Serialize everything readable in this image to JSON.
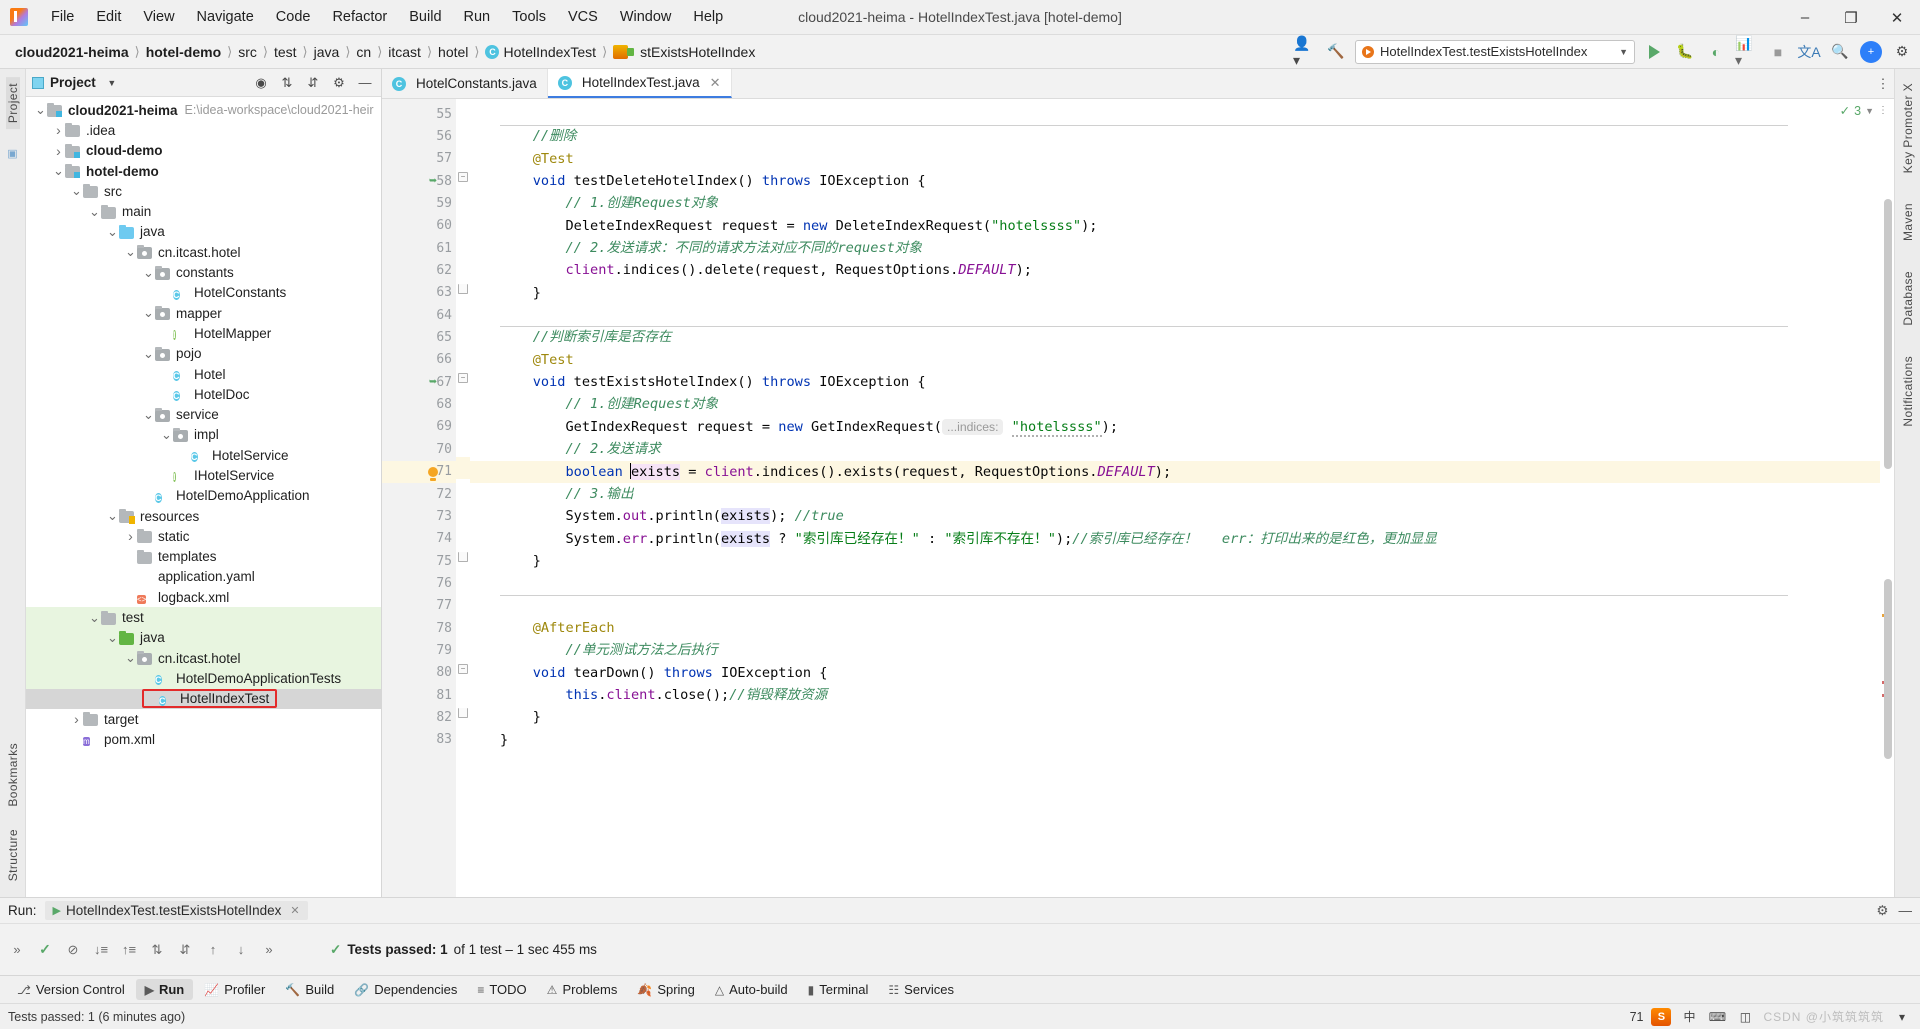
{
  "window": {
    "title": "cloud2021-heima - HotelIndexTest.java [hotel-demo]",
    "minimize": "–",
    "maximize": "❐",
    "close": "✕"
  },
  "menubar": {
    "items": [
      "File",
      "Edit",
      "View",
      "Navigate",
      "Code",
      "Refactor",
      "Build",
      "Run",
      "Tools",
      "VCS",
      "Window",
      "Help"
    ]
  },
  "breadcrumb": {
    "items": [
      {
        "label": "cloud2021-heima",
        "bold": true
      },
      {
        "label": "hotel-demo",
        "bold": true
      },
      {
        "label": "src",
        "bold": false
      },
      {
        "label": "test",
        "bold": false
      },
      {
        "label": "java",
        "bold": false
      },
      {
        "label": "cn",
        "bold": false
      },
      {
        "label": "itcast",
        "bold": false
      },
      {
        "label": "hotel",
        "bold": false
      },
      {
        "label": "HotelIndexTest",
        "bold": false,
        "icon": "class-icon"
      },
      {
        "label": "stExistsHotelIndex",
        "bold": false,
        "icon": "method-icon"
      }
    ]
  },
  "toolbar": {
    "run_configuration": "HotelIndexTest.testExistsHotelIndex",
    "run_tooltip": "Run",
    "debug_tooltip": "Debug",
    "coverage_tooltip": "Run with Coverage",
    "profiler_tooltip": "Profiler",
    "stop_tooltip": "Stop",
    "translate_tooltip": "Translate",
    "search_tooltip": "Search Everywhere",
    "settings_tooltip": "Settings",
    "user_initial": "👤",
    "update_badge": "+"
  },
  "left_strip": {
    "items": [
      "Project",
      "Bookmarks",
      "Structure"
    ]
  },
  "right_strip": {
    "items": [
      "Key Promoter X",
      "Maven",
      "Database",
      "Notifications"
    ]
  },
  "project_panel": {
    "title": "Project",
    "tree": [
      {
        "depth": 0,
        "arrow": "v",
        "icon": "module-folder",
        "label": "cloud2021-heima",
        "bold": true,
        "path": "E:\\idea-workspace\\cloud2021-heir"
      },
      {
        "depth": 1,
        "arrow": ">",
        "icon": "folder",
        "label": ".idea",
        "bold": false
      },
      {
        "depth": 1,
        "arrow": ">",
        "icon": "module-folder",
        "label": "cloud-demo",
        "bold": true
      },
      {
        "depth": 1,
        "arrow": "v",
        "icon": "module-folder",
        "label": "hotel-demo",
        "bold": true
      },
      {
        "depth": 2,
        "arrow": "v",
        "icon": "folder",
        "label": "src",
        "bold": false
      },
      {
        "depth": 3,
        "arrow": "v",
        "icon": "folder",
        "label": "main",
        "bold": false
      },
      {
        "depth": 4,
        "arrow": "v",
        "icon": "source-folder",
        "label": "java",
        "bold": false
      },
      {
        "depth": 5,
        "arrow": "v",
        "icon": "package",
        "label": "cn.itcast.hotel",
        "bold": false
      },
      {
        "depth": 6,
        "arrow": "v",
        "icon": "package",
        "label": "constants",
        "bold": false
      },
      {
        "depth": 7,
        "arrow": "",
        "icon": "class",
        "label": "HotelConstants",
        "bold": false
      },
      {
        "depth": 6,
        "arrow": "v",
        "icon": "package",
        "label": "mapper",
        "bold": false
      },
      {
        "depth": 7,
        "arrow": "",
        "icon": "interface",
        "label": "HotelMapper",
        "bold": false
      },
      {
        "depth": 6,
        "arrow": "v",
        "icon": "package",
        "label": "pojo",
        "bold": false
      },
      {
        "depth": 7,
        "arrow": "",
        "icon": "class",
        "label": "Hotel",
        "bold": false
      },
      {
        "depth": 7,
        "arrow": "",
        "icon": "class",
        "label": "HotelDoc",
        "bold": false
      },
      {
        "depth": 6,
        "arrow": "v",
        "icon": "package",
        "label": "service",
        "bold": false
      },
      {
        "depth": 7,
        "arrow": "v",
        "icon": "package",
        "label": "impl",
        "bold": false
      },
      {
        "depth": 8,
        "arrow": "",
        "icon": "class",
        "label": "HotelService",
        "bold": false
      },
      {
        "depth": 7,
        "arrow": "",
        "icon": "interface",
        "label": "IHotelService",
        "bold": false
      },
      {
        "depth": 6,
        "arrow": "",
        "icon": "spring-class",
        "label": "HotelDemoApplication",
        "bold": false
      },
      {
        "depth": 4,
        "arrow": "v",
        "icon": "resource-folder",
        "label": "resources",
        "bold": false
      },
      {
        "depth": 5,
        "arrow": ">",
        "icon": "folder",
        "label": "static",
        "bold": false
      },
      {
        "depth": 5,
        "arrow": "",
        "icon": "folder",
        "label": "templates",
        "bold": false
      },
      {
        "depth": 5,
        "arrow": "",
        "icon": "yaml-file",
        "label": "application.yaml",
        "bold": false
      },
      {
        "depth": 5,
        "arrow": "",
        "icon": "xml-file",
        "label": "logback.xml",
        "bold": false
      },
      {
        "depth": 3,
        "arrow": "v",
        "icon": "folder",
        "label": "test",
        "bold": false,
        "highlight": "green"
      },
      {
        "depth": 4,
        "arrow": "v",
        "icon": "test-source-folder",
        "label": "java",
        "bold": false,
        "highlight": "green"
      },
      {
        "depth": 5,
        "arrow": "v",
        "icon": "package",
        "label": "cn.itcast.hotel",
        "bold": false,
        "highlight": "green"
      },
      {
        "depth": 6,
        "arrow": "",
        "icon": "test-class",
        "label": "HotelDemoApplicationTests",
        "bold": false,
        "highlight": "green"
      },
      {
        "depth": 6,
        "arrow": "",
        "icon": "test-class",
        "label": "HotelIndexTest",
        "bold": false,
        "highlight": "selected",
        "outlined": true
      },
      {
        "depth": 2,
        "arrow": ">",
        "icon": "folder",
        "label": "target",
        "bold": false
      },
      {
        "depth": 2,
        "arrow": "",
        "icon": "maven-file",
        "label": "pom.xml",
        "bold": false
      }
    ]
  },
  "editor": {
    "tabs": [
      {
        "label": "HotelConstants.java",
        "icon": "class-icon",
        "active": false,
        "closable": false
      },
      {
        "label": "HotelIndexTest.java",
        "icon": "test-class-icon",
        "active": true,
        "closable": true
      }
    ],
    "inspection_count": "3",
    "lines": [
      {
        "n": "55",
        "segments": []
      },
      {
        "n": "56",
        "segments": [
          {
            "t": "    //删除",
            "c": "com-green"
          }
        ],
        "separator_above": true
      },
      {
        "n": "57",
        "segments": [
          {
            "t": "    @Test",
            "c": "ann"
          }
        ]
      },
      {
        "n": "58",
        "segments": [
          {
            "t": "    ",
            "c": "plain"
          },
          {
            "t": "void",
            "c": "kw"
          },
          {
            "t": " testDeleteHotelIndex() ",
            "c": "plain"
          },
          {
            "t": "throws",
            "c": "kw"
          },
          {
            "t": " IOException {",
            "c": "plain"
          }
        ],
        "gutter_icon": "run-test",
        "fold": "collapse"
      },
      {
        "n": "59",
        "segments": [
          {
            "t": "        // 1.创建Request对象",
            "c": "com-green"
          }
        ]
      },
      {
        "n": "60",
        "segments": [
          {
            "t": "        DeleteIndexRequest request = ",
            "c": "plain"
          },
          {
            "t": "new",
            "c": "kw"
          },
          {
            "t": " DeleteIndexRequest(",
            "c": "plain"
          },
          {
            "t": "\"hotelssss\"",
            "c": "str"
          },
          {
            "t": ");",
            "c": "plain"
          }
        ]
      },
      {
        "n": "61",
        "segments": [
          {
            "t": "        // 2.发送请求：不同的请求方法对应不同的request对象",
            "c": "com-green"
          }
        ]
      },
      {
        "n": "62",
        "segments": [
          {
            "t": "        ",
            "c": "plain"
          },
          {
            "t": "client",
            "c": "fld"
          },
          {
            "t": ".indices().delete(request, RequestOptions.",
            "c": "plain"
          },
          {
            "t": "DEFAULT",
            "c": "stat"
          },
          {
            "t": ");",
            "c": "plain"
          }
        ]
      },
      {
        "n": "63",
        "segments": [
          {
            "t": "    }",
            "c": "plain"
          }
        ],
        "fold": "end"
      },
      {
        "n": "64",
        "segments": []
      },
      {
        "n": "65",
        "segments": [
          {
            "t": "    //判断索引库是否存在",
            "c": "com-green"
          }
        ],
        "separator_above": true
      },
      {
        "n": "66",
        "segments": [
          {
            "t": "    @Test",
            "c": "ann"
          }
        ]
      },
      {
        "n": "67",
        "segments": [
          {
            "t": "    ",
            "c": "plain"
          },
          {
            "t": "void",
            "c": "kw"
          },
          {
            "t": " testExistsHotelIndex() ",
            "c": "plain"
          },
          {
            "t": "throws",
            "c": "kw"
          },
          {
            "t": " IOException {",
            "c": "plain"
          }
        ],
        "gutter_icon": "run-test",
        "fold": "collapse"
      },
      {
        "n": "68",
        "segments": [
          {
            "t": "        // 1.创建Request对象",
            "c": "com-green"
          }
        ]
      },
      {
        "n": "69",
        "segments": [
          {
            "t": "        GetIndexRequest request = ",
            "c": "plain"
          },
          {
            "t": "new",
            "c": "kw"
          },
          {
            "t": " GetIndexRequest(",
            "c": "plain"
          },
          {
            "t": "...indices:",
            "c": "hint"
          },
          {
            "t": " ",
            "c": "plain"
          },
          {
            "t": "\"hotelssss\"",
            "c": "str-wavy"
          },
          {
            "t": ");",
            "c": "plain"
          }
        ]
      },
      {
        "n": "70",
        "segments": [
          {
            "t": "        // 2.发送请求",
            "c": "com-green"
          }
        ]
      },
      {
        "n": "71",
        "segments": [
          {
            "t": "        ",
            "c": "plain"
          },
          {
            "t": "boolean",
            "c": "kw"
          },
          {
            "t": " ",
            "c": "plain"
          },
          {
            "t": "|exists",
            "c": "ident-caret"
          },
          {
            "t": " = ",
            "c": "plain"
          },
          {
            "t": "client",
            "c": "fld"
          },
          {
            "t": ".indices().exists(request, RequestOptions.",
            "c": "plain"
          },
          {
            "t": "DEFAULT",
            "c": "stat"
          },
          {
            "t": ");",
            "c": "plain"
          }
        ],
        "gutter_icon": "bulb",
        "highlight": true
      },
      {
        "n": "72",
        "segments": [
          {
            "t": "        // 3.输出",
            "c": "com-green"
          }
        ]
      },
      {
        "n": "73",
        "segments": [
          {
            "t": "        System.",
            "c": "plain"
          },
          {
            "t": "out",
            "c": "fld"
          },
          {
            "t": ".println(",
            "c": "plain"
          },
          {
            "t": "exists",
            "c": "ident-hl2"
          },
          {
            "t": "); ",
            "c": "plain"
          },
          {
            "t": "//true",
            "c": "com-green"
          }
        ]
      },
      {
        "n": "74",
        "segments": [
          {
            "t": "        System.",
            "c": "plain"
          },
          {
            "t": "err",
            "c": "fld"
          },
          {
            "t": ".println(",
            "c": "plain"
          },
          {
            "t": "exists",
            "c": "ident-hl2"
          },
          {
            "t": " ? ",
            "c": "plain"
          },
          {
            "t": "\"索引库已经存在！\"",
            "c": "str"
          },
          {
            "t": " : ",
            "c": "plain"
          },
          {
            "t": "\"索引库不存在！\"",
            "c": "str"
          },
          {
            "t": ");",
            "c": "plain"
          },
          {
            "t": "//索引库已经存在！   err：打印出来的是红色，更加显显",
            "c": "com-green"
          }
        ]
      },
      {
        "n": "75",
        "segments": [
          {
            "t": "    }",
            "c": "plain"
          }
        ],
        "fold": "end"
      },
      {
        "n": "76",
        "segments": []
      },
      {
        "n": "77",
        "segments": [],
        "separator_above": true
      },
      {
        "n": "78",
        "segments": [
          {
            "t": "    @AfterEach",
            "c": "ann"
          }
        ]
      },
      {
        "n": "79",
        "segments": [
          {
            "t": "        //单元测试方法之后执行",
            "c": "com-green"
          }
        ]
      },
      {
        "n": "80",
        "segments": [
          {
            "t": "    ",
            "c": "plain"
          },
          {
            "t": "void",
            "c": "kw"
          },
          {
            "t": " tearDown() ",
            "c": "plain"
          },
          {
            "t": "throws",
            "c": "kw"
          },
          {
            "t": " IOException {",
            "c": "plain"
          }
        ],
        "fold": "collapse"
      },
      {
        "n": "81",
        "segments": [
          {
            "t": "        ",
            "c": "plain"
          },
          {
            "t": "this",
            "c": "kw"
          },
          {
            "t": ".",
            "c": "plain"
          },
          {
            "t": "client",
            "c": "fld"
          },
          {
            "t": ".close();",
            "c": "plain"
          },
          {
            "t": "//销毁释放资源",
            "c": "com-green"
          }
        ]
      },
      {
        "n": "82",
        "segments": [
          {
            "t": "    }",
            "c": "plain"
          }
        ],
        "fold": "end"
      },
      {
        "n": "83",
        "segments": [
          {
            "t": "}",
            "c": "plain"
          }
        ]
      }
    ]
  },
  "run_panel": {
    "label": "Run:",
    "tab_title": "HotelIndexTest.testExistsHotelIndex",
    "tab_close": "✕",
    "status_text": "Tests passed: 1",
    "status_detail": "of 1 test – 1 sec 455 ms",
    "settings_icon": "gear-icon",
    "minimize_icon": "minimize-icon"
  },
  "tool_windows": {
    "items": [
      {
        "label": "Version Control",
        "icon": "branch-icon",
        "active": false
      },
      {
        "label": "Run",
        "icon": "run-icon",
        "active": true
      },
      {
        "label": "Profiler",
        "icon": "profiler-icon",
        "active": false
      },
      {
        "label": "Build",
        "icon": "hammer-icon",
        "active": false
      },
      {
        "label": "Dependencies",
        "icon": "dependencies-icon",
        "active": false
      },
      {
        "label": "TODO",
        "icon": "todo-icon",
        "active": false
      },
      {
        "label": "Problems",
        "icon": "problems-icon",
        "active": false
      },
      {
        "label": "Spring",
        "icon": "spring-icon",
        "active": false
      },
      {
        "label": "Auto-build",
        "icon": "autobuild-icon",
        "active": false
      },
      {
        "label": "Terminal",
        "icon": "terminal-icon",
        "active": false
      },
      {
        "label": "Services",
        "icon": "services-icon",
        "active": false
      }
    ]
  },
  "statusbar": {
    "message": "Tests passed: 1 (6 minutes ago)",
    "zoom": "71",
    "ime_lang": "中",
    "watermark": "CSDN @小筑筑筑筑"
  }
}
